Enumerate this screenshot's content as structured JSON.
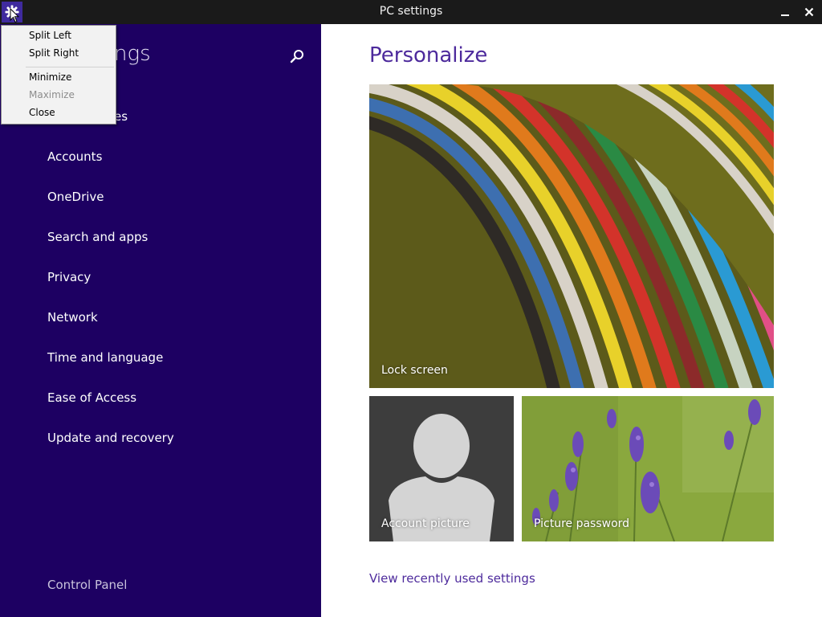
{
  "window": {
    "title": "PC settings",
    "icon": "gear-icon",
    "minimize_label": "–",
    "close_label": "✕"
  },
  "system_menu": {
    "items": [
      {
        "label": "Split Left",
        "enabled": true
      },
      {
        "label": "Split Right",
        "enabled": true
      },
      {
        "label": "Minimize",
        "enabled": true
      },
      {
        "label": "Maximize",
        "enabled": false
      },
      {
        "label": "Close",
        "enabled": true
      }
    ]
  },
  "sidebar": {
    "title": "ngs",
    "partial_item": "es",
    "search_icon": "search-icon",
    "items": [
      {
        "label": "Accounts"
      },
      {
        "label": "OneDrive"
      },
      {
        "label": "Search and apps"
      },
      {
        "label": "Privacy"
      },
      {
        "label": "Network"
      },
      {
        "label": "Time and language"
      },
      {
        "label": "Ease of Access"
      },
      {
        "label": "Update and recovery"
      }
    ],
    "control_panel": "Control Panel"
  },
  "main": {
    "title": "Personalize",
    "tiles": [
      {
        "label": "Lock screen"
      },
      {
        "label": "Account picture"
      },
      {
        "label": "Picture password"
      }
    ],
    "recent_link": "View recently used settings"
  },
  "colors": {
    "sidebar_bg": "#1d0062",
    "accent": "#4d2a9c",
    "titlebar_bg": "#1a1a1a"
  }
}
